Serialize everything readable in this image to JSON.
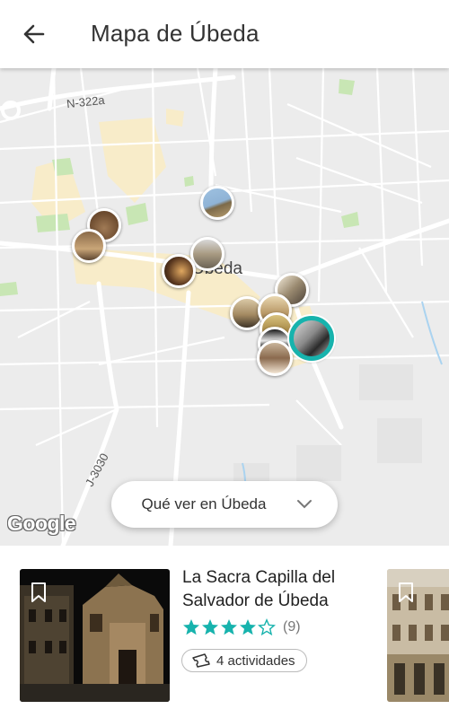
{
  "appbar": {
    "title": "Mapa de Úbeda"
  },
  "map": {
    "road_labels": {
      "n322a": "N-322a",
      "j3030": "J-3030"
    },
    "city_label": "Úbeda",
    "attribution": "Google",
    "filter_pill": {
      "label": "Qué ver en Úbeda"
    }
  },
  "card": {
    "title": "La Sacra Capilla del Salvador de Úbeda",
    "rating": 4,
    "rating_max": 5,
    "reviews": "(9)",
    "activities": "4 actividades"
  },
  "colors": {
    "accent": "#17b3ad",
    "park": "#c8e6b4",
    "highlight": "#f8ecc9"
  },
  "icons": [
    "back-arrow-icon",
    "chevron-down-icon",
    "bookmark-icon",
    "star-icon",
    "ticket-icon"
  ]
}
